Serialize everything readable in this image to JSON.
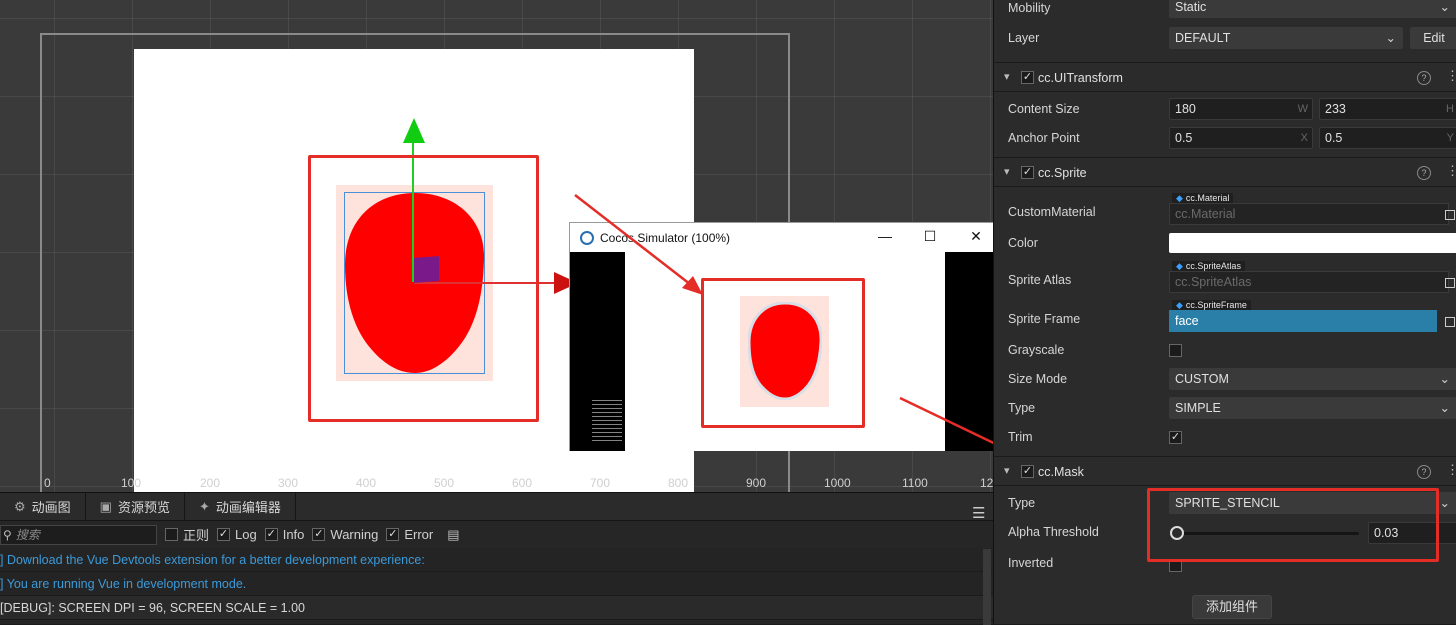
{
  "scene": {
    "ruler_labels": [
      "0",
      "100",
      "200",
      "300",
      "400",
      "500",
      "600",
      "700",
      "800",
      "900",
      "1000",
      "1100",
      "12"
    ]
  },
  "simulator": {
    "title": "Cocos Simulator (100%)",
    "minimize": "—",
    "maximize": "☐",
    "close": "✕"
  },
  "console": {
    "tabs": [
      {
        "label": "动画图",
        "icon": "animation-graph-icon"
      },
      {
        "label": "资源预览",
        "icon": "asset-preview-icon"
      },
      {
        "label": "动画编辑器",
        "icon": "animation-editor-icon"
      }
    ],
    "search_placeholder": "搜索",
    "filters": [
      {
        "label": "正则",
        "checked": false
      },
      {
        "label": "Log",
        "checked": true
      },
      {
        "label": "Info",
        "checked": true
      },
      {
        "label": "Warning",
        "checked": true
      },
      {
        "label": "Error",
        "checked": true
      }
    ],
    "lines": [
      {
        "text": "] Download the Vue Devtools extension for a better development experience:",
        "kind": "info"
      },
      {
        "text": "] You are running Vue in development mode.",
        "kind": "info"
      },
      {
        "text": " [DEBUG]: SCREEN DPI = 96, SCREEN SCALE = 1.00",
        "kind": "plain"
      }
    ]
  },
  "inspector": {
    "mobility_label": "Mobility",
    "mobility_value": "Static",
    "layer_label": "Layer",
    "layer_value": "DEFAULT",
    "layer_edit": "Edit",
    "uitransform_title": "cc.UITransform",
    "content_size_label": "Content Size",
    "content_w": "180",
    "content_w_axis": "W",
    "content_h": "233",
    "content_h_axis": "H",
    "anchor_label": "Anchor Point",
    "anchor_x": "0.5",
    "anchor_x_axis": "X",
    "anchor_y": "0.5",
    "anchor_y_axis": "Y",
    "sprite_title": "cc.Sprite",
    "custom_material_label": "CustomMaterial",
    "custom_material_tag": "cc.Material",
    "custom_material_value": "cc.Material",
    "color_label": "Color",
    "sprite_atlas_label": "Sprite Atlas",
    "sprite_atlas_tag": "cc.SpriteAtlas",
    "sprite_atlas_value": "cc.SpriteAtlas",
    "sprite_frame_label": "Sprite Frame",
    "sprite_frame_tag": "cc.SpriteFrame",
    "sprite_frame_value": "face",
    "grayscale_label": "Grayscale",
    "size_mode_label": "Size Mode",
    "size_mode_value": "CUSTOM",
    "type_label": "Type",
    "type_value": "SIMPLE",
    "trim_label": "Trim",
    "mask_title": "cc.Mask",
    "mask_type_label": "Type",
    "mask_type_value": "SPRITE_STENCIL",
    "alpha_threshold_label": "Alpha Threshold",
    "alpha_threshold_value": "0.03",
    "alpha_threshold_fraction": 0.03,
    "inverted_label": "Inverted",
    "add_component": "添加组件"
  },
  "colors": {
    "annotation_red": "#e52d27",
    "sprite_red": "#ff0000",
    "selection_blue": "#2a7fa8"
  }
}
